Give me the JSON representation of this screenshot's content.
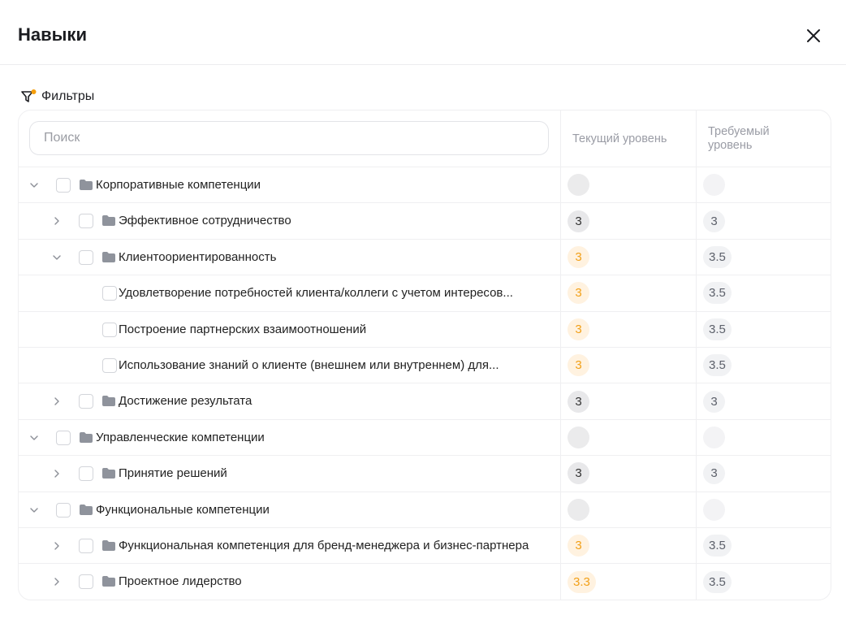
{
  "title": "Навыки",
  "filters_label": "Фильтры",
  "search_placeholder": "Поиск",
  "columns": {
    "current": "Текущий уровень",
    "required_line1": "Требуемый",
    "required_line2": "уровень"
  },
  "colors": {
    "accent": "#f2a019",
    "filter_dot": "#f59e0b"
  },
  "rows": [
    {
      "level": 0,
      "expand": "down",
      "folder": true,
      "label": "Корпоративные компетенции",
      "current": "",
      "current_style": "empty",
      "required": ""
    },
    {
      "level": 1,
      "expand": "right",
      "folder": true,
      "label": "Эффективное сотрудничество",
      "current": "3",
      "current_style": "gray",
      "required": "3"
    },
    {
      "level": 1,
      "expand": "down",
      "folder": true,
      "label": "Клиентоориентированность",
      "current": "3",
      "current_style": "orange",
      "required": "3.5"
    },
    {
      "level": 2,
      "expand": "",
      "folder": false,
      "label": "Удовлетворение потребностей клиента/коллеги с учетом интересов...",
      "current": "3",
      "current_style": "orange",
      "required": "3.5"
    },
    {
      "level": 2,
      "expand": "",
      "folder": false,
      "label": "Построение партнерских взаимоотношений",
      "current": "3",
      "current_style": "orange",
      "required": "3.5"
    },
    {
      "level": 2,
      "expand": "",
      "folder": false,
      "label": "Использование знаний о клиенте (внешнем или внутреннем) для...",
      "current": "3",
      "current_style": "orange",
      "required": "3.5"
    },
    {
      "level": 1,
      "expand": "right",
      "folder": true,
      "label": "Достижение результата",
      "current": "3",
      "current_style": "gray",
      "required": "3"
    },
    {
      "level": 0,
      "expand": "down",
      "folder": true,
      "label": "Управленческие компетенции",
      "current": "",
      "current_style": "empty",
      "required": ""
    },
    {
      "level": 1,
      "expand": "right",
      "folder": true,
      "label": "Принятие решений",
      "current": "3",
      "current_style": "gray",
      "required": "3"
    },
    {
      "level": 0,
      "expand": "down",
      "folder": true,
      "label": "Функциональные компетенции",
      "current": "",
      "current_style": "empty",
      "required": ""
    },
    {
      "level": 1,
      "expand": "right",
      "folder": true,
      "label": "Функциональная компетенция для бренд-менеджера и бизнес-партнера",
      "current": "3",
      "current_style": "orange",
      "required": "3.5"
    },
    {
      "level": 1,
      "expand": "right",
      "folder": true,
      "label": "Проектное лидерство",
      "current": "3.3",
      "current_style": "orange",
      "required": "3.5"
    }
  ]
}
